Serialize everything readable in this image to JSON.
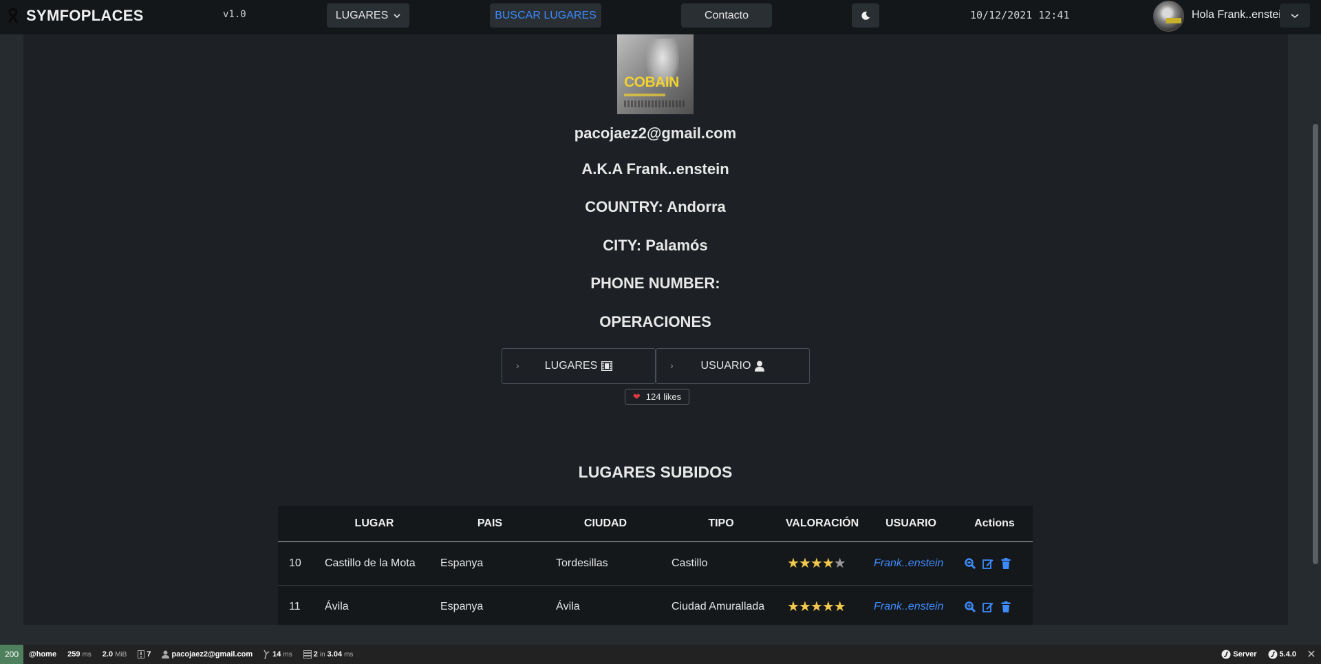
{
  "navbar": {
    "brand": "SYMFOPLACES",
    "version": "v1.0",
    "lugares_menu": "LUGARES",
    "buscar": "BUSCAR LUGARES",
    "contacto": "Contacto",
    "datetime": "10/12/2021 12:41",
    "greeting": "Hola Frank..enstein"
  },
  "profile": {
    "poster_title": "COBAIN",
    "email": "pacojaez2@gmail.com",
    "aka": "A.K.A Frank..enstein",
    "country": "COUNTRY: Andorra",
    "city": "CITY: Palamós",
    "phone": "PHONE NUMBER:",
    "operaciones": "OPERACIONES",
    "btn_lugares": "LUGARES",
    "btn_usuario": "USUARIO",
    "likes": "124 likes"
  },
  "section_title": "LUGARES SUBIDOS",
  "table": {
    "headers": [
      "",
      "LUGAR",
      "PAIS",
      "CIUDAD",
      "TIPO",
      "VALORACIÓN",
      "USUARIO",
      "Actions"
    ],
    "rows": [
      {
        "id": "10",
        "lugar": "Castillo de la Mota",
        "pais": "Espanya",
        "ciudad": "Tordesillas",
        "tipo": "Castillo",
        "stars": 4,
        "usuario": "Frank..enstein"
      },
      {
        "id": "11",
        "lugar": "Ávila",
        "pais": "Espanya",
        "ciudad": "Ávila",
        "tipo": "Ciudad Amurallada",
        "stars": 5,
        "usuario": "Frank..enstein"
      }
    ]
  },
  "toolbar": {
    "status": "200",
    "route": "@home",
    "time_value": "259",
    "time_unit": "ms",
    "memory_value": "2.0",
    "memory_unit": "MiB",
    "logs": "7",
    "user": "pacojaez2@gmail.com",
    "twig_value": "14",
    "twig_unit": "ms",
    "db_value": "2",
    "db_in": "in",
    "db_time": "3.04",
    "db_unit": "ms",
    "server": "Server",
    "sf_version": "5.4.0"
  },
  "colors": {
    "accent": "#3d8bfd",
    "star": "#f2c94c",
    "heart": "#e03a3e",
    "status_ok": "#4f805d"
  }
}
